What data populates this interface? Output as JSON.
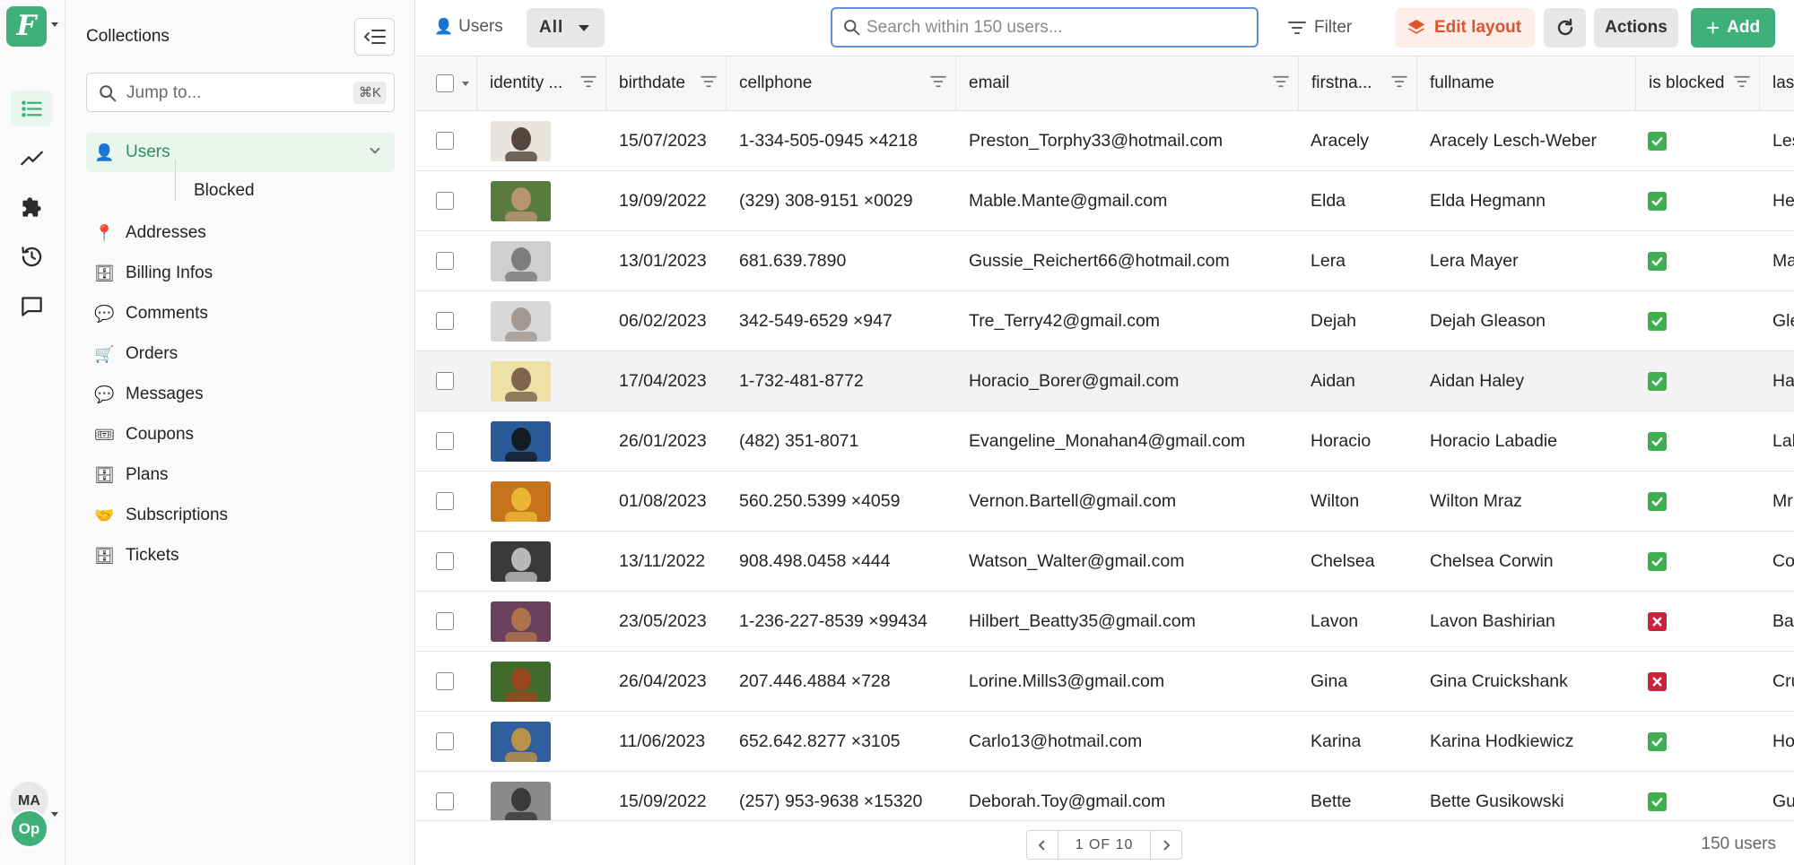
{
  "app": {
    "logo_letter": "F",
    "brand_color": "#3fb07a"
  },
  "rail": {
    "items": [
      "list-icon",
      "chart-icon",
      "puzzle-icon",
      "history-icon",
      "comment-icon"
    ],
    "user_initials": "MA",
    "workspace_initials": "Op"
  },
  "collections": {
    "title": "Collections",
    "jump_placeholder": "Jump to...",
    "jump_shortcut": "⌘K",
    "items": [
      {
        "label": "Users",
        "icon": "👤",
        "active": true
      },
      {
        "label": "Blocked",
        "sub": true
      },
      {
        "label": "Addresses",
        "icon": "📍"
      },
      {
        "label": "Billing Infos",
        "icon": "🗄"
      },
      {
        "label": "Comments",
        "icon": "💬"
      },
      {
        "label": "Orders",
        "icon": "🛒"
      },
      {
        "label": "Messages",
        "icon": "💬"
      },
      {
        "label": "Coupons",
        "icon": "🎟"
      },
      {
        "label": "Plans",
        "icon": "🗄"
      },
      {
        "label": "Subscriptions",
        "icon": "🤝"
      },
      {
        "label": "Tickets",
        "icon": "🗄"
      }
    ]
  },
  "toolbar": {
    "collection_label": "Users",
    "segment": "All",
    "search_placeholder": "Search within 150 users...",
    "filter_label": "Filter",
    "edit_layout_label": "Edit layout",
    "actions_label": "Actions",
    "add_label": "Add"
  },
  "table": {
    "columns": [
      "identity ...",
      "birthdate",
      "cellphone",
      "email",
      "firstna...",
      "fullname",
      "is blocked",
      "las"
    ],
    "rows": [
      {
        "birthdate": "15/07/2023",
        "cellphone": "1-334-505-0945 ×4218",
        "email": "Preston_Torphy33@hotmail.com",
        "firstname": "Aracely",
        "fullname": "Aracely Lesch-Weber",
        "blocked": true,
        "last": "Les"
      },
      {
        "birthdate": "19/09/2022",
        "cellphone": "(329) 308-9151 ×0029",
        "email": "Mable.Mante@gmail.com",
        "firstname": "Elda",
        "fullname": "Elda Hegmann",
        "blocked": true,
        "last": "He"
      },
      {
        "birthdate": "13/01/2023",
        "cellphone": "681.639.7890",
        "email": "Gussie_Reichert66@hotmail.com",
        "firstname": "Lera",
        "fullname": "Lera Mayer",
        "blocked": true,
        "last": "Ma"
      },
      {
        "birthdate": "06/02/2023",
        "cellphone": "342-549-6529 ×947",
        "email": "Tre_Terry42@gmail.com",
        "firstname": "Dejah",
        "fullname": "Dejah Gleason",
        "blocked": true,
        "last": "Gle"
      },
      {
        "birthdate": "17/04/2023",
        "cellphone": "1-732-481-8772",
        "email": "Horacio_Borer@gmail.com",
        "firstname": "Aidan",
        "fullname": "Aidan Haley",
        "blocked": true,
        "last": "Ha"
      },
      {
        "birthdate": "26/01/2023",
        "cellphone": "(482) 351-8071",
        "email": "Evangeline_Monahan4@gmail.com",
        "firstname": "Horacio",
        "fullname": "Horacio Labadie",
        "blocked": true,
        "last": "Lab"
      },
      {
        "birthdate": "01/08/2023",
        "cellphone": "560.250.5399 ×4059",
        "email": "Vernon.Bartell@gmail.com",
        "firstname": "Wilton",
        "fullname": "Wilton Mraz",
        "blocked": true,
        "last": "Mr"
      },
      {
        "birthdate": "13/11/2022",
        "cellphone": "908.498.0458 ×444",
        "email": "Watson_Walter@gmail.com",
        "firstname": "Chelsea",
        "fullname": "Chelsea Corwin",
        "blocked": true,
        "last": "Co"
      },
      {
        "birthdate": "23/05/2023",
        "cellphone": "1-236-227-8539 ×99434",
        "email": "Hilbert_Beatty35@gmail.com",
        "firstname": "Lavon",
        "fullname": "Lavon Bashirian",
        "blocked": false,
        "last": "Ba"
      },
      {
        "birthdate": "26/04/2023",
        "cellphone": "207.446.4884 ×728",
        "email": "Lorine.Mills3@gmail.com",
        "firstname": "Gina",
        "fullname": "Gina Cruickshank",
        "blocked": false,
        "last": "Cru"
      },
      {
        "birthdate": "11/06/2023",
        "cellphone": "652.642.8277 ×3105",
        "email": "Carlo13@hotmail.com",
        "firstname": "Karina",
        "fullname": "Karina Hodkiewicz",
        "blocked": true,
        "last": "Ho"
      },
      {
        "birthdate": "15/09/2022",
        "cellphone": "(257) 953-9638 ×15320",
        "email": "Deborah.Toy@gmail.com",
        "firstname": "Bette",
        "fullname": "Bette Gusikowski",
        "blocked": true,
        "last": "Gu"
      }
    ]
  },
  "footer": {
    "page_label": "1 OF 10",
    "count_label": "150 users"
  },
  "colors": {
    "accent": "#3fb07a",
    "edit_layout": "#e0552e",
    "blocked_yes": "#3fb04f",
    "blocked_no": "#c8233d",
    "search_focus": "#5c8fd6"
  }
}
